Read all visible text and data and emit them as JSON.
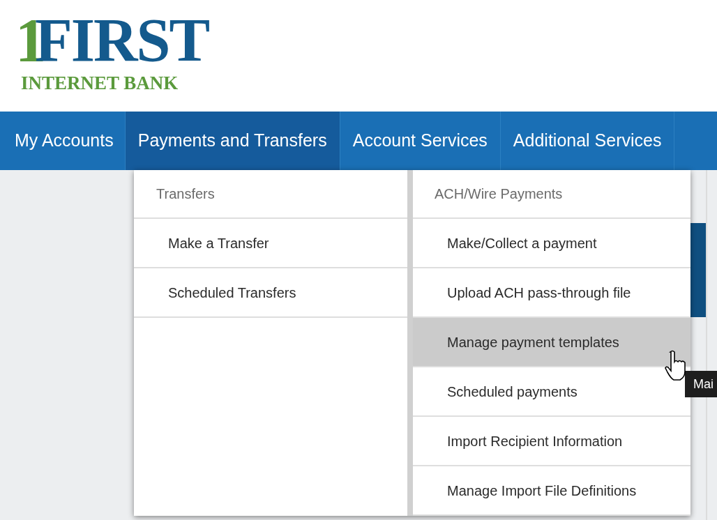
{
  "logo": {
    "numeral": "1",
    "word": "FIRST",
    "tagline": "INTERNET BANK"
  },
  "nav": [
    {
      "label": "My Accounts",
      "selected": false
    },
    {
      "label": "Payments and Transfers",
      "selected": true
    },
    {
      "label": "Account Services",
      "selected": false
    },
    {
      "label": "Additional Services",
      "selected": false
    }
  ],
  "menu": {
    "columns": [
      {
        "heading": "Transfers",
        "items": [
          {
            "label": "Make a Transfer",
            "hovered": false
          },
          {
            "label": "Scheduled Transfers",
            "hovered": false
          }
        ]
      },
      {
        "heading": "ACH/Wire Payments",
        "items": [
          {
            "label": "Make/Collect a payment",
            "hovered": false
          },
          {
            "label": "Upload ACH pass-through file",
            "hovered": false
          },
          {
            "label": "Manage payment templates",
            "hovered": true
          },
          {
            "label": "Scheduled payments",
            "hovered": false
          },
          {
            "label": "Import Recipient Information",
            "hovered": false
          },
          {
            "label": "Manage Import File Definitions",
            "hovered": false
          }
        ]
      }
    ]
  },
  "tooltip": "Mai"
}
